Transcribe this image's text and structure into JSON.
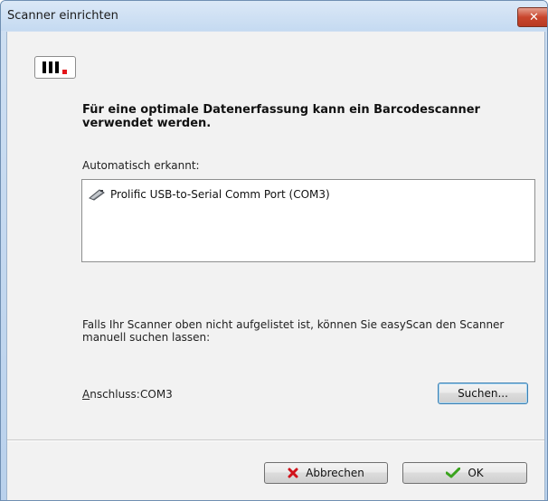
{
  "window": {
    "title": "Scanner einrichten",
    "close_label": "✕"
  },
  "heading": "Für eine optimale Datenerfassung kann ein Barcodescanner verwendet werden.",
  "detected": {
    "label": "Automatisch erkannt:",
    "items": [
      {
        "label": "Prolific USB-to-Serial Comm Port (COM3)",
        "icon": "usb-device-icon"
      }
    ]
  },
  "hint": "Falls Ihr Scanner oben nicht aufgelistet ist, können Sie easyScan den Scanner manuell suchen lassen:",
  "port": {
    "label_underlined": "A",
    "label_rest": "nschluss:",
    "value": "COM3"
  },
  "buttons": {
    "search": "Suchen...",
    "cancel": "Abbrechen",
    "ok": "OK"
  },
  "colors": {
    "accent_close": "#c9462d",
    "logo_dot": "#e3151a",
    "cancel_icon": "#d0121b",
    "ok_icon": "#3aa31d"
  }
}
